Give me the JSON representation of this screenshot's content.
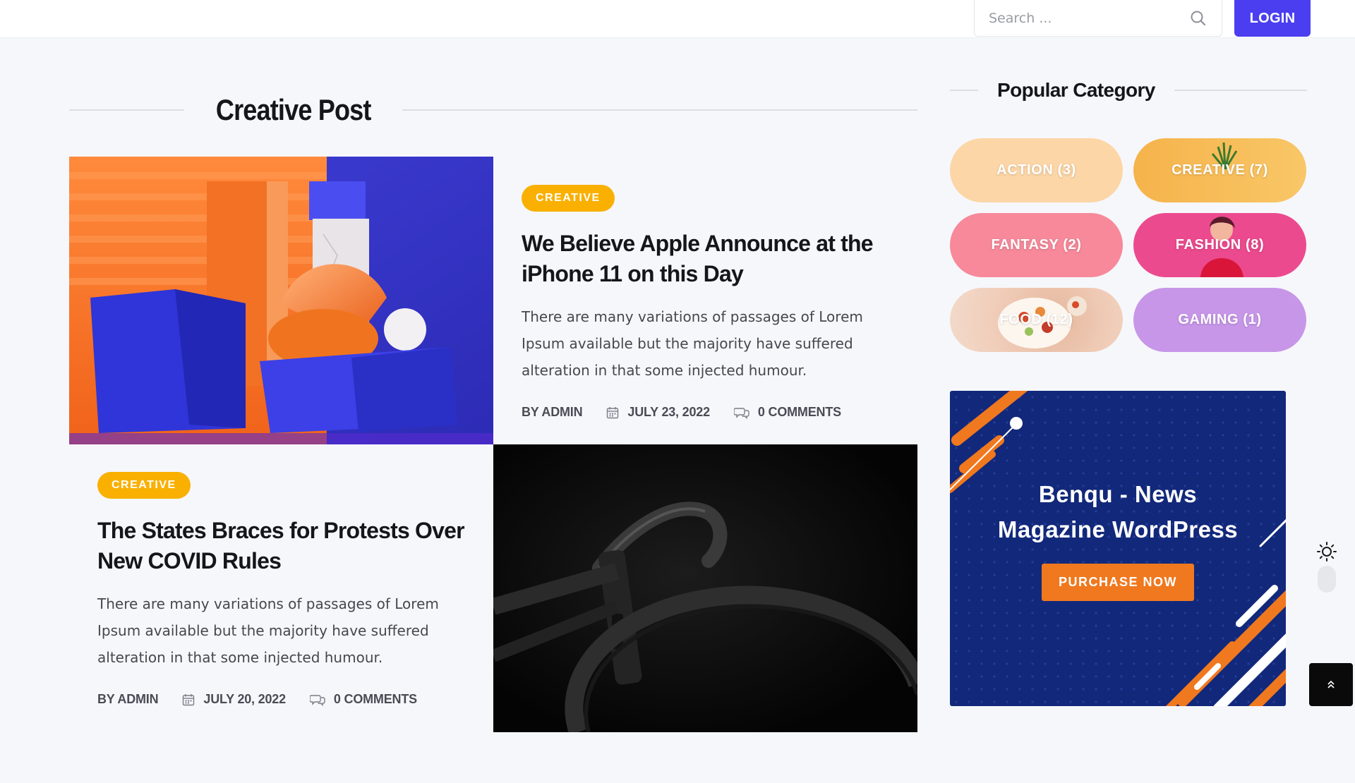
{
  "header": {
    "search_placeholder": "Search ...",
    "login_label": "LOGIN"
  },
  "section": {
    "title": "Creative Post"
  },
  "posts": [
    {
      "category": "CREATIVE",
      "title": "We Believe Apple Announce at the iPhone 11 on this Day",
      "excerpt": "There are many variations of passages of Lorem Ipsum available but the majority have suffered alteration in that some injected humour.",
      "author": "BY ADMIN",
      "date": "JULY 23, 2022",
      "comments": "0 COMMENTS"
    },
    {
      "category": "CREATIVE",
      "title": "The States Braces for Protests Over New COVID Rules",
      "excerpt": "There are many variations of passages of Lorem Ipsum available but the majority have suffered alteration in that some injected humour.",
      "author": "BY ADMIN",
      "date": "JULY 20, 2022",
      "comments": "0 COMMENTS"
    }
  ],
  "sidebar": {
    "title": "Popular Category",
    "categories": [
      {
        "label": "ACTION (3)"
      },
      {
        "label": "CREATIVE (7)"
      },
      {
        "label": "FANTASY (2)"
      },
      {
        "label": "FASHION (8)"
      },
      {
        "label": "FOOD (12)"
      },
      {
        "label": "GAMING (1)"
      }
    ],
    "ad": {
      "title_line1": "Benqu - News",
      "title_line2": "Magazine WordPress",
      "button_label": "PURCHASE NOW"
    }
  },
  "colors": {
    "accent": "#4b3ef0",
    "badge": "#f9b000",
    "ad_background": "#12287a",
    "ad_button": "#f0781e"
  },
  "icons": [
    "search-icon",
    "calendar-icon",
    "comments-icon",
    "sun-icon",
    "chevron-up-icon"
  ]
}
